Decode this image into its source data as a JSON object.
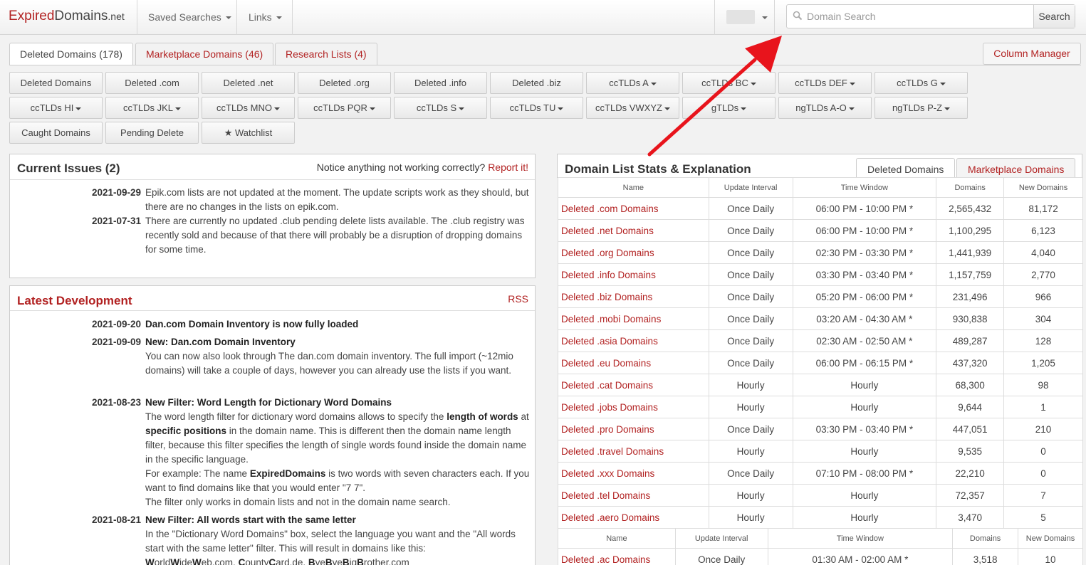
{
  "navbar": {
    "logo_part1": "Expired",
    "logo_part2": "Domains",
    "logo_part3": ".net",
    "saved_searches": "Saved Searches",
    "links": "Links",
    "search_placeholder": "Domain Search",
    "search_button": "Search"
  },
  "tabs": {
    "deleted": "Deleted Domains (178)",
    "marketplace": "Marketplace Domains (46)",
    "research": "Research Lists (4)",
    "column_manager": "Column Manager"
  },
  "buttons": [
    {
      "label": "Deleted Domains",
      "dropdown": false
    },
    {
      "label": "Deleted .com",
      "dropdown": false
    },
    {
      "label": "Deleted .net",
      "dropdown": false
    },
    {
      "label": "Deleted .org",
      "dropdown": false
    },
    {
      "label": "Deleted .info",
      "dropdown": false
    },
    {
      "label": "Deleted .biz",
      "dropdown": false
    },
    {
      "label": "ccTLDs A",
      "dropdown": true
    },
    {
      "label": "ccTLDs BC",
      "dropdown": true
    },
    {
      "label": "ccTLDs DEF",
      "dropdown": true
    },
    {
      "label": "ccTLDs G",
      "dropdown": true
    },
    {
      "label": "ccTLDs HI",
      "dropdown": true
    },
    {
      "label": "ccTLDs JKL",
      "dropdown": true
    },
    {
      "label": "ccTLDs MNO",
      "dropdown": true
    },
    {
      "label": "ccTLDs PQR",
      "dropdown": true
    },
    {
      "label": "ccTLDs S",
      "dropdown": true
    },
    {
      "label": "ccTLDs TU",
      "dropdown": true
    },
    {
      "label": "ccTLDs VWXYZ",
      "dropdown": true
    },
    {
      "label": "gTLDs",
      "dropdown": true
    },
    {
      "label": "ngTLDs A-O",
      "dropdown": true
    },
    {
      "label": "ngTLDs P-Z",
      "dropdown": true
    },
    {
      "label": "Caught Domains",
      "dropdown": false
    },
    {
      "label": "Pending Delete",
      "dropdown": false
    },
    {
      "label": "★ Watchlist",
      "dropdown": false
    }
  ],
  "issues": {
    "title": "Current Issues (2)",
    "notice": "Notice anything not working correctly?",
    "report_link": "Report it!",
    "items": [
      {
        "date": "2021-09-29",
        "text": "Epik.com lists are not updated at the moment. The update scripts work as they should, but there are no changes in the lists on epik.com."
      },
      {
        "date": "2021-07-31",
        "text": "There are currently no updated .club pending delete lists available. The .club registry was recently sold and because of that there will probably be a disruption of dropping domains for some time."
      }
    ]
  },
  "development": {
    "title": "Latest Development",
    "rss": "RSS",
    "items": [
      {
        "date": "2021-09-20",
        "title": "Dan.com Domain Inventory is now fully loaded"
      },
      {
        "date": "2021-09-09",
        "title": "New: Dan.com Domain Inventory",
        "text": "You can now also look through The dan.com domain inventory. The full import (~12mio domains) will take a couple of days, however you can already use the lists if you want."
      },
      {
        "date": "2021-08-23",
        "title": "New Filter: Word Length for Dictionary Word Domains",
        "p1_a": "The word length filter for dictionary word domains allows to specify the ",
        "p1_b1": "length of words",
        "p1_c": " at ",
        "p1_b2": "specific positions",
        "p1_d": " in the domain name. This is different then the domain name length filter, because this filter specifies the length of single words found inside the domain name in the specific language.",
        "p2_a": "For example: The name ",
        "p2_b": "ExpiredDomains",
        "p2_c": " is two words with seven characters each. If you want to find domains like that you would enter \"7 7\".",
        "p3": "The filter only works in domain lists and not in the domain name search."
      },
      {
        "date": "2021-08-21",
        "title": "New Filter: All words start with the same letter",
        "text": "In the \"Dictionary Word Domains\" box, select the language you want and the \"All words start with the same letter\" filter. This will result in domains like this:",
        "example": "WorldWideWeb.com, CountyCard.de, ByeByeBigBrother.com"
      }
    ]
  },
  "stats": {
    "title": "Domain List Stats & Explanation",
    "tab_deleted": "Deleted Domains",
    "tab_marketplace": "Marketplace Domains",
    "headers": [
      "Name",
      "Update Interval",
      "Time Window",
      "Domains",
      "New Domains"
    ],
    "rows": [
      [
        "Deleted .com Domains",
        "Once Daily",
        "06:00 PM - 10:00 PM *",
        "2,565,432",
        "81,172"
      ],
      [
        "Deleted .net Domains",
        "Once Daily",
        "06:00 PM - 10:00 PM *",
        "1,100,295",
        "6,123"
      ],
      [
        "Deleted .org Domains",
        "Once Daily",
        "02:30 PM - 03:30 PM *",
        "1,441,939",
        "4,040"
      ],
      [
        "Deleted .info Domains",
        "Once Daily",
        "03:30 PM - 03:40 PM *",
        "1,157,759",
        "2,770"
      ],
      [
        "Deleted .biz Domains",
        "Once Daily",
        "05:20 PM - 06:00 PM *",
        "231,496",
        "966"
      ],
      [
        "Deleted .mobi Domains",
        "Once Daily",
        "03:20 AM - 04:30 AM *",
        "930,838",
        "304"
      ],
      [
        "Deleted .asia Domains",
        "Once Daily",
        "02:30 AM - 02:50 AM *",
        "489,287",
        "128"
      ],
      [
        "Deleted .eu Domains",
        "Once Daily",
        "06:00 PM - 06:15 PM *",
        "437,320",
        "1,205"
      ],
      [
        "Deleted .cat Domains",
        "Hourly",
        "Hourly",
        "68,300",
        "98"
      ],
      [
        "Deleted .jobs Domains",
        "Hourly",
        "Hourly",
        "9,644",
        "1"
      ],
      [
        "Deleted .pro Domains",
        "Once Daily",
        "03:30 PM - 03:40 PM *",
        "447,051",
        "210"
      ],
      [
        "Deleted .travel Domains",
        "Hourly",
        "Hourly",
        "9,535",
        "0"
      ],
      [
        "Deleted .xxx Domains",
        "Once Daily",
        "07:10 PM - 08:00 PM *",
        "22,210",
        "0"
      ],
      [
        "Deleted .tel Domains",
        "Hourly",
        "Hourly",
        "72,357",
        "7"
      ],
      [
        "Deleted .aero Domains",
        "Hourly",
        "Hourly",
        "3,470",
        "5"
      ]
    ],
    "rows2": [
      [
        "Deleted .ac Domains",
        "Once Daily",
        "01:30 AM - 02:00 AM *",
        "3,518",
        "10"
      ]
    ]
  },
  "colors": {
    "accent": "#b22222",
    "arrow": "#e8141c"
  }
}
